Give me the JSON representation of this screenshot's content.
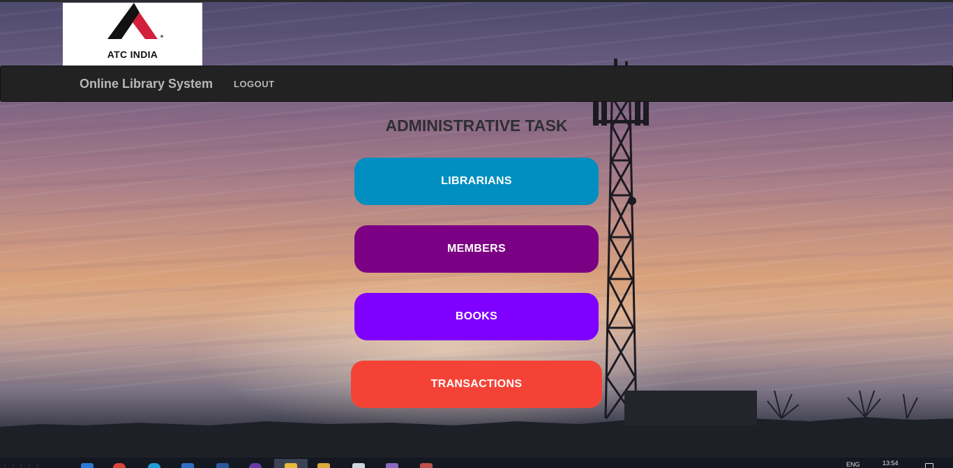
{
  "logo": {
    "text": "ATC INDIA",
    "colors": {
      "black": "#111111",
      "red": "#d21f3c"
    }
  },
  "navbar": {
    "brand": "Online Library System",
    "logout_label": "LOGOUT"
  },
  "main": {
    "title": "ADMINISTRATIVE TASK",
    "buttons": [
      {
        "label": "LIBRARIANS",
        "color": "#018ec0"
      },
      {
        "label": "MEMBERS",
        "color": "#7c0083"
      },
      {
        "label": "BOOKS",
        "color": "#7f00ff"
      },
      {
        "label": "TRANSACTIONS",
        "color": "#f44336"
      }
    ]
  },
  "taskbar": {
    "language": "ENG",
    "time": "13:54",
    "icons": [
      "taskbar-app-icon",
      "chrome-icon",
      "edge-icon",
      "mail-icon",
      "word-icon",
      "app-icon",
      "folder-icon",
      "file-explorer-icon",
      "notepad-icon",
      "calendar-icon",
      "paint-icon"
    ]
  }
}
